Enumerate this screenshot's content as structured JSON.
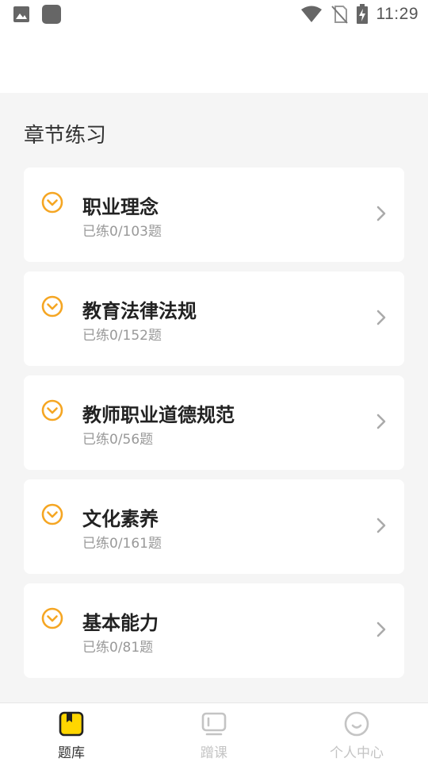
{
  "status_bar": {
    "time": "11:29",
    "icons": [
      "image-icon",
      "app-square-icon",
      "wifi-icon",
      "no-sim-icon",
      "battery-charging-icon"
    ]
  },
  "section": {
    "title": "章节练习"
  },
  "chapters": [
    {
      "title": "职业理念",
      "progress": "已练0/103题"
    },
    {
      "title": "教育法律法规",
      "progress": "已练0/152题"
    },
    {
      "title": "教师职业道德规范",
      "progress": "已练0/56题"
    },
    {
      "title": "文化素养",
      "progress": "已练0/161题"
    },
    {
      "title": "基本能力",
      "progress": "已练0/81题"
    }
  ],
  "tab_bar": {
    "tabs": [
      {
        "label": "题库",
        "icon": "question-bank-icon",
        "active": true
      },
      {
        "label": "蹭课",
        "icon": "tv-icon",
        "active": false
      },
      {
        "label": "个人中心",
        "icon": "smiley-icon",
        "active": false
      }
    ]
  },
  "colors": {
    "accent_orange": "#f5a623",
    "accent_yellow": "#ffd600",
    "background": "#f5f5f5"
  }
}
